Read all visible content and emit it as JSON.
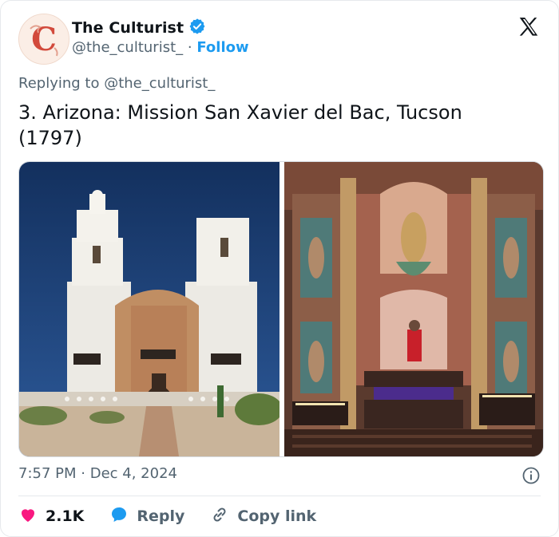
{
  "author": {
    "display_name": "The Culturist",
    "handle": "@the_culturist_",
    "separator": "·",
    "follow_label": "Follow",
    "avatar_letter": "C"
  },
  "replying": {
    "prefix": "Replying to",
    "handle": "@the_culturist_"
  },
  "tweet": {
    "text": "3. Arizona: Mission San Xavier del Bac, Tucson (1797)",
    "time": "7:57 PM",
    "date_separator": "·",
    "date": "Dec 4, 2024"
  },
  "actions": {
    "likes": "2.1K",
    "reply_label": "Reply",
    "copy_link_label": "Copy link"
  },
  "colors": {
    "accent": "#1d9bf0",
    "like": "#f91880",
    "muted": "#536471",
    "text": "#0f1419"
  },
  "icons": [
    "verified-badge-icon",
    "x-logo-icon",
    "info-icon",
    "heart-icon",
    "reply-bubble-icon",
    "link-icon"
  ]
}
